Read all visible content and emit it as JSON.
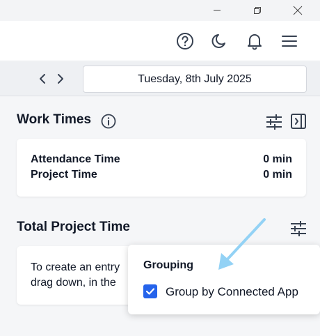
{
  "window": {
    "controls": [
      "minimize-icon",
      "restore-icon",
      "close-icon"
    ]
  },
  "header": {
    "icons": [
      "help-icon",
      "moon-icon",
      "bell-icon",
      "menu-icon"
    ]
  },
  "date_nav": {
    "date_label": "Tuesday, 8th July 2025"
  },
  "work_times": {
    "title": "Work Times",
    "rows": [
      {
        "label": "Attendance Time",
        "value": "0 min"
      },
      {
        "label": "Project Time",
        "value": "0 min"
      }
    ]
  },
  "total_project": {
    "title": "Total Project Time",
    "hint_line1": "To create an entry",
    "hint_line2": "drag down, in the"
  },
  "grouping_popover": {
    "heading": "Grouping",
    "option_label": "Group by Connected App",
    "option_checked": true
  },
  "colors": {
    "accent": "#2563eb",
    "arrow": "#93d2f5"
  }
}
